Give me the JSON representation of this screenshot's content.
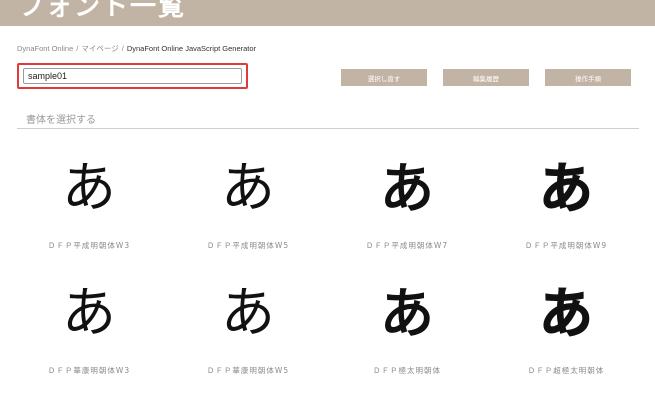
{
  "header": {
    "title": "フォント一覧"
  },
  "breadcrumb": {
    "items": [
      "DynaFont Online",
      "マイページ"
    ],
    "separator": "/",
    "current": "DynaFont Online JavaScript Generator"
  },
  "project_input": {
    "value": "sample01"
  },
  "toolbar": {
    "reselect_label": "選択し直す",
    "history_label": "編集履歴",
    "manual_label": "操作手順"
  },
  "section": {
    "heading": "書体を選択する"
  },
  "fonts": [
    {
      "glyph": "あ",
      "name": "ＤＦＰ平成明朝体W3"
    },
    {
      "glyph": "あ",
      "name": "ＤＦＰ平成明朝体W5"
    },
    {
      "glyph": "あ",
      "name": "ＤＦＰ平成明朝体W7"
    },
    {
      "glyph": "あ",
      "name": "ＤＦＰ平成明朝体W9"
    },
    {
      "glyph": "あ",
      "name": "ＤＦＰ華康明朝体W3"
    },
    {
      "glyph": "あ",
      "name": "ＤＦＰ華康明朝体W5"
    },
    {
      "glyph": "あ",
      "name": "ＤＦＰ極太明朝体"
    },
    {
      "glyph": "あ",
      "name": "ＤＦＰ超極太明朝体"
    }
  ],
  "colors": {
    "header_bg": "#c2b4a4",
    "button_bg": "#c2b4a4",
    "highlight_border": "#e03a3a"
  }
}
